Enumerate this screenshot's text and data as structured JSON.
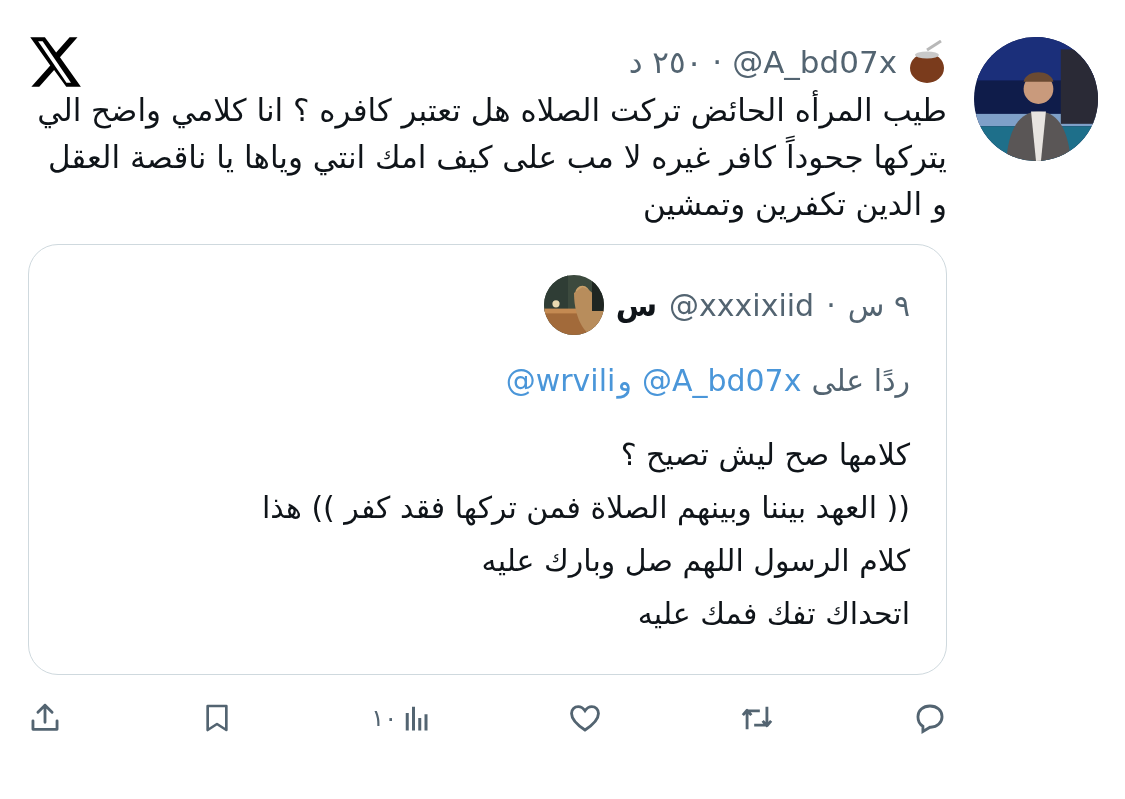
{
  "tweet": {
    "author_handle": "@A_bd07x",
    "separator": "·",
    "time": "٢٥٠ د",
    "text": "طيب المرأه الحائض تركت الصلاه هل تعتبر كافره ؟ انا كلامي واضح الي يتركها جحوداً كافر غيره لا مب على كيف امك انتي وياها يا ناقصة العقل و الدين تكفرين وتمشين",
    "quoted": {
      "name": "س",
      "handle": "@xxxixiid",
      "separator": "·",
      "time": "٩ س",
      "replying_to": {
        "label": "ردًا على",
        "mentions": [
          "@A_bd07x",
          "@wrvili"
        ],
        "joiner": "و"
      },
      "lines": [
        "كلامها صح ليش تصيح ؟",
        "(( العهد بيننا وبينهم الصلاة فمن تركها فقد كفر )) هذا",
        "كلام الرسول اللهم صل وبارك عليه",
        "اتحداك تفك فمك عليه"
      ]
    },
    "actions": [
      {
        "kind": "reply"
      },
      {
        "kind": "retweet"
      },
      {
        "kind": "like"
      },
      {
        "kind": "views",
        "count": "١٠"
      },
      {
        "kind": "bookmark"
      },
      {
        "kind": "share"
      }
    ]
  }
}
